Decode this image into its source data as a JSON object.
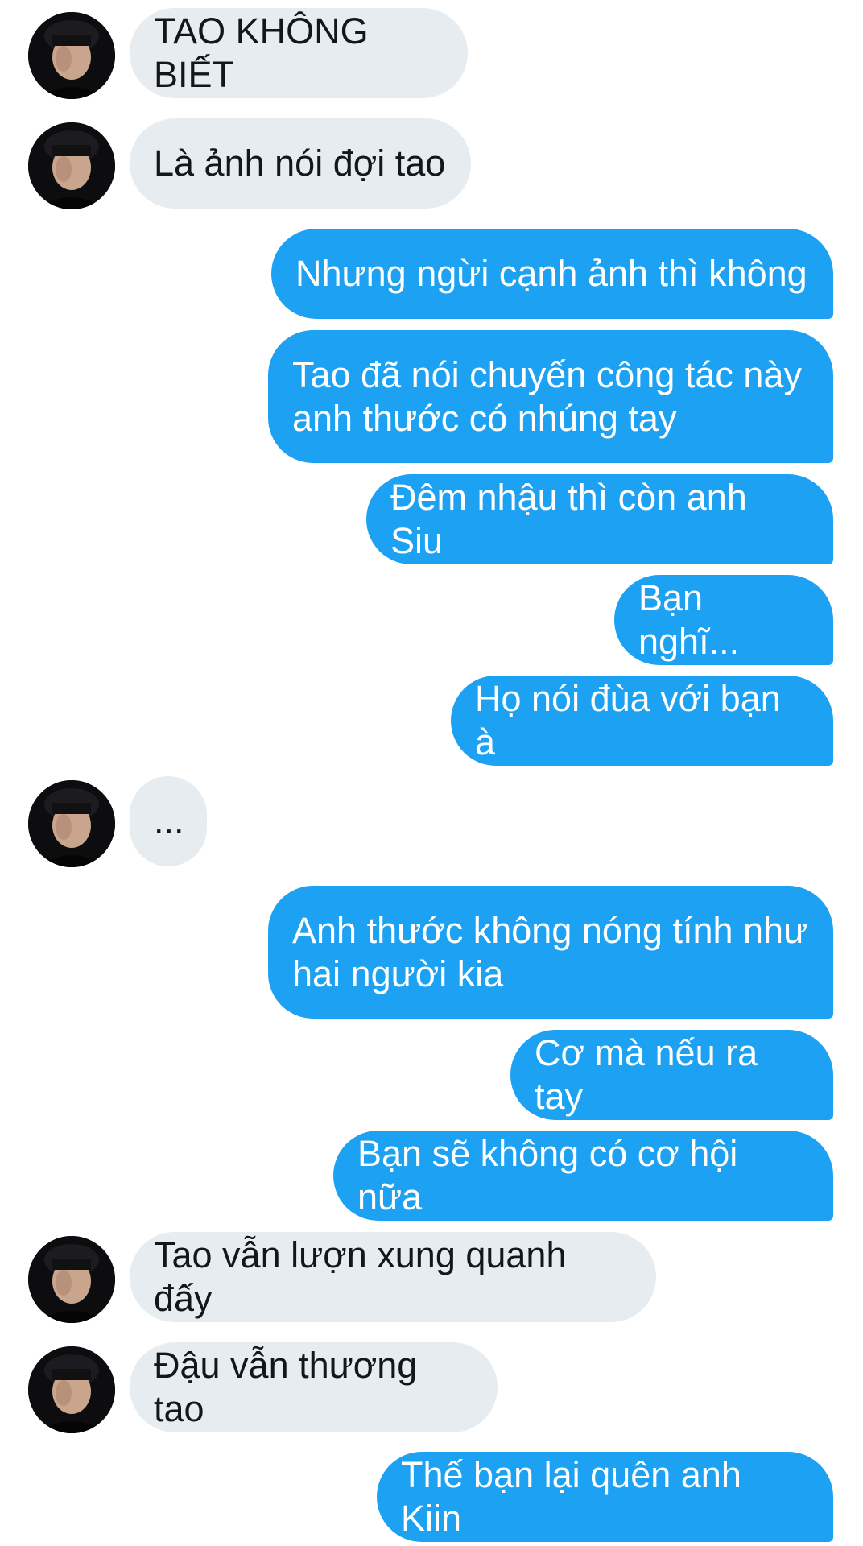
{
  "messages": [
    {
      "side": "in",
      "text": "TAO KHÔNG BIẾT"
    },
    {
      "side": "in",
      "text": "Là ảnh nói đợi tao"
    },
    {
      "side": "out",
      "text": "Nhưng ngừi cạnh ảnh thì không"
    },
    {
      "side": "out",
      "text": "Tao đã nói chuyến công tác này\nanh thước có nhúng tay"
    },
    {
      "side": "out",
      "text": "Đêm nhậu thì còn anh Siu"
    },
    {
      "side": "out",
      "text": "Bạn nghĩ..."
    },
    {
      "side": "out",
      "text": "Họ nói đùa với bạn à"
    },
    {
      "side": "in",
      "text": "..."
    },
    {
      "side": "out",
      "text": "Anh thước không nóng tính như\nhai người kia"
    },
    {
      "side": "out",
      "text": "Cơ mà nếu ra tay"
    },
    {
      "side": "out",
      "text": "Bạn sẽ không có cơ hội nữa"
    },
    {
      "side": "in",
      "text": "Tao vẫn lượn xung quanh đấy"
    },
    {
      "side": "in",
      "text": "Đậu vẫn thương tao"
    },
    {
      "side": "out",
      "text": "Thế bạn lại quên anh Kiin"
    }
  ],
  "icons": {
    "avatar": "user-avatar-photo"
  },
  "colors": {
    "outgoing_bubble": "#1da1f2",
    "incoming_bubble": "#e6ecf0",
    "incoming_text": "#14171a",
    "outgoing_text": "#ffffff"
  }
}
